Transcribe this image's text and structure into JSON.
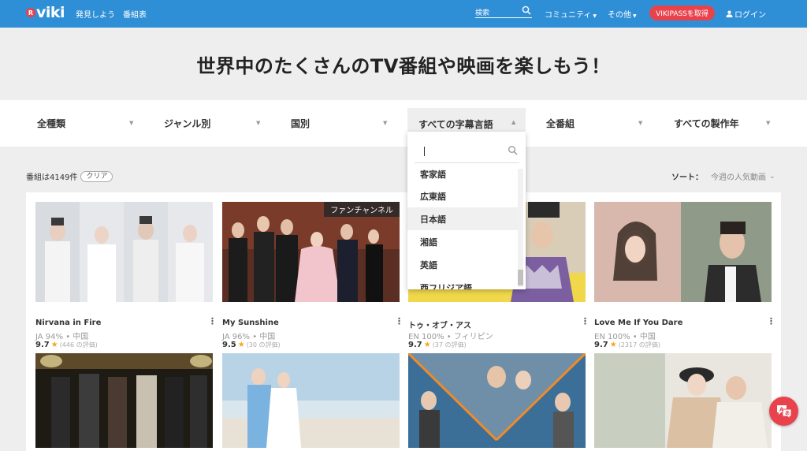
{
  "nav": {
    "logo_badge": "R",
    "logo_text": "viki",
    "links": [
      "発見しよう",
      "番組表"
    ],
    "search_label": "検索",
    "community": "コミュニティ",
    "other": "その他",
    "vikipass": "VIKIPASSを取得",
    "login": "ログイン"
  },
  "hero": {
    "title": "世界中のたくさんのTV番組や映画を楽しもう！"
  },
  "filters": [
    {
      "label": "全種類"
    },
    {
      "label": "ジャンル別"
    },
    {
      "label": "国別"
    },
    {
      "label": "すべての字幕言語"
    },
    {
      "label": "全番組"
    },
    {
      "label": "すべての製作年"
    }
  ],
  "dropdown": {
    "items": [
      "客家語",
      "広東語",
      "日本語",
      "湘語",
      "英語",
      "西フリジア語"
    ],
    "hover_item": "日本語"
  },
  "results": {
    "count_text": "番組は4149件",
    "clear_label": "クリア",
    "sort_label": "ソート：",
    "sort_value": "今週の人気動画"
  },
  "cards": [
    {
      "title": "Nirvana in Fire",
      "meta": "JA 94% • 中国",
      "rating": "9.7",
      "reviews": "(446 の評価)",
      "badge": ""
    },
    {
      "title": "My Sunshine",
      "meta": "JA 96% • 中国",
      "rating": "9.5",
      "reviews": "(30 の評価)",
      "badge": "ファンチャンネル"
    },
    {
      "title": "トゥ・オブ・アス",
      "meta": "EN 100% • フィリピン",
      "rating": "9.7",
      "reviews": "(37 の評価)",
      "badge": ""
    },
    {
      "title": "Love Me If You Dare",
      "meta": "EN 100% • 中国",
      "rating": "9.7",
      "reviews": "(2317 の評価)",
      "badge": ""
    }
  ],
  "colors": {
    "nav_bg": "#2f8fd6",
    "accent": "#e8434d",
    "star": "#f5a623"
  }
}
